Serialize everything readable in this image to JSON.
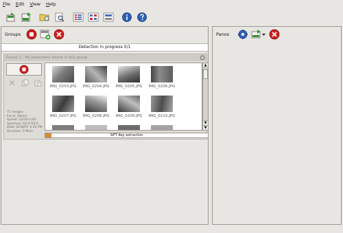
{
  "menu": {
    "file": "File",
    "edit": "Edit",
    "view": "View",
    "help": "Help"
  },
  "toolbar": {
    "buttons": [
      "new-project-icon",
      "save-project-icon",
      "open-folder-icon",
      "find-images-icon",
      "list-view-icon",
      "grid-view-icon",
      "details-view-icon",
      "info-icon",
      "help-icon"
    ]
  },
  "left_panel": {
    "label": "Groups",
    "status": "Detection in progress 0/1",
    "group": {
      "title": "Group 1 - No panorama found in this group",
      "info_lines": [
        "71 images",
        "Focal: 28mm",
        "Speed: 1/250-1/40",
        "Aperture: f/4.5-f/9.0",
        "Date: 8/18/07 4:35 PM",
        "Duration: 0 Mins"
      ],
      "thumbnails": [
        "IMG_0203.JPG",
        "IMG_0204.JPG",
        "IMG_0205.JPG",
        "IMG_0206.JPG",
        "IMG_0207.JPG",
        "IMG_0208.JPG",
        "IMG_0209.JPG",
        "IMG_0210.JPG"
      ],
      "progress_label": "SIFT Key extraction",
      "progress_fraction": 0.04
    }
  },
  "right_panel": {
    "label": "Panos"
  },
  "colors": {
    "stop_red": "#cc1f1f",
    "progress_orange": "#d98b32"
  }
}
